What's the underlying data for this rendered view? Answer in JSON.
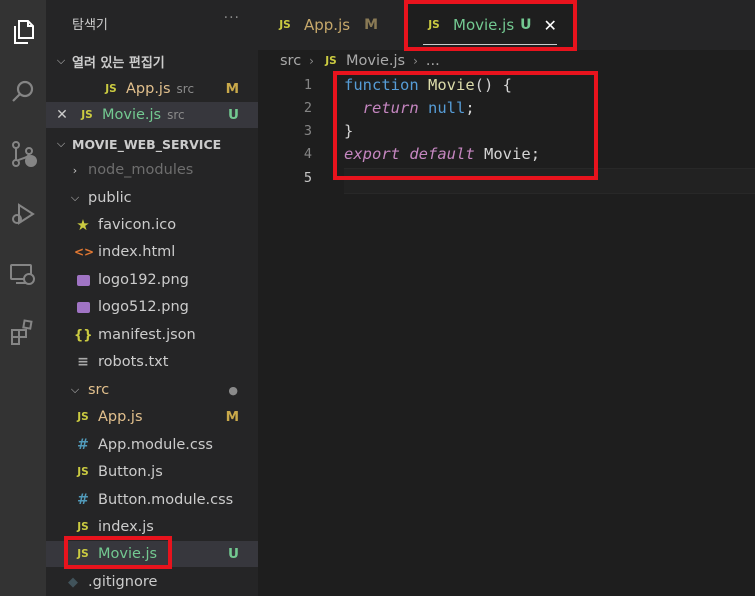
{
  "explorer": {
    "title": "탐색기",
    "more_label": "···",
    "open_editors": {
      "header": "열려 있는 편집기",
      "items": [
        {
          "name": "App.js",
          "path": "src",
          "status": "M"
        },
        {
          "name": "Movie.js",
          "path": "src",
          "status": "U"
        }
      ]
    },
    "project": {
      "header": "MOVIE_WEB_SERVICE",
      "node_modules": "node_modules",
      "public": {
        "label": "public",
        "files": [
          "favicon.ico",
          "index.html",
          "logo192.png",
          "logo512.png",
          "manifest.json",
          "robots.txt"
        ]
      },
      "src": {
        "label": "src",
        "dot": "●",
        "files": [
          {
            "name": "App.js",
            "status": "M"
          },
          {
            "name": "App.module.css",
            "status": ""
          },
          {
            "name": "Button.js",
            "status": ""
          },
          {
            "name": "Button.module.css",
            "status": ""
          },
          {
            "name": "index.js",
            "status": ""
          },
          {
            "name": "Movie.js",
            "status": "U"
          }
        ]
      },
      "gitignore": ".gitignore"
    }
  },
  "tabs": [
    {
      "name": "App.js",
      "status": "M",
      "icon": "JS"
    },
    {
      "name": "Movie.js",
      "status": "U",
      "icon": "JS",
      "close": "✕"
    }
  ],
  "breadcrumb": {
    "folder": "src",
    "sep": "›",
    "file": "Movie.js",
    "more": "..."
  },
  "code": {
    "line_numbers": [
      "1",
      "2",
      "3",
      "4",
      "5"
    ],
    "l1_kw": "function",
    "l1_fn": "Movie",
    "l1_rest": "() {",
    "l2_indent": "  ",
    "l2_kw": "return",
    "l2_null": "null",
    "l2_semi": ";",
    "l3": "}",
    "l4_kw1": "export",
    "l4_kw2": "default",
    "l4_id": "Movie",
    "l4_semi": ";"
  },
  "colors": {
    "highlight": "#e8131d",
    "js_icon": "#cbcb41",
    "modified": "#c9a94a",
    "untracked": "#73c991"
  }
}
